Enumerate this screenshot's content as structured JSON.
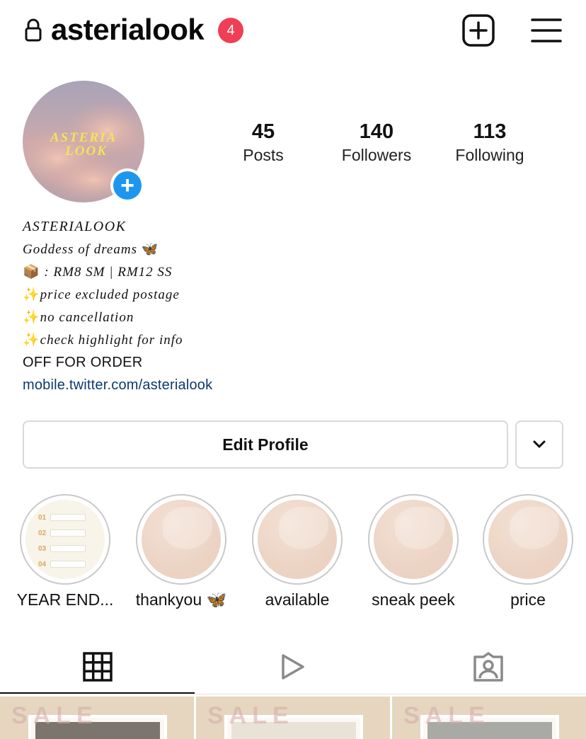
{
  "header": {
    "username": "asterialook",
    "notification_count": "4",
    "icons": [
      "lock-icon",
      "new-post-icon",
      "menu-icon"
    ]
  },
  "profile": {
    "avatar_text": "ASTERIA LOOK",
    "stats": [
      {
        "value": "45",
        "label": "Posts"
      },
      {
        "value": "140",
        "label": "Followers"
      },
      {
        "value": "113",
        "label": "Following"
      }
    ]
  },
  "bio": {
    "name": "ASTERIALOOK",
    "line1_text": "Goddess of dreams",
    "line1_emoji": "🦋",
    "line2_emoji": "📦",
    "line2_text": ": RM8 SM | RM12 SS",
    "line3_emoji": "✨",
    "line3_text": "price excluded postage",
    "line4_emoji": "✨",
    "line4_text": "no cancellation",
    "line5_emoji": "✨",
    "line5_text": "check highlight for info",
    "line6_text": "OFF FOR ORDER",
    "link": "mobile.twitter.com/asterialook"
  },
  "actions": {
    "edit_profile_label": "Edit Profile"
  },
  "highlights": [
    {
      "label": "YEAR END..."
    },
    {
      "label": "thankyou 🦋"
    },
    {
      "label": "available"
    },
    {
      "label": "sneak peek"
    },
    {
      "label": "price"
    }
  ],
  "highlight_doc_numbers": [
    "01",
    "02",
    "03",
    "04"
  ],
  "tabs": [
    {
      "icon": "grid-icon",
      "active": true
    },
    {
      "icon": "reels-icon",
      "active": false
    },
    {
      "icon": "tagged-icon",
      "active": false
    }
  ],
  "posts": [
    {
      "overlay_text": "SALE"
    },
    {
      "overlay_text": "SALE"
    },
    {
      "overlay_text": "SALE"
    }
  ],
  "colors": {
    "notification_badge": "#ef3e56",
    "add_button": "#1d96f0",
    "link": "#0d3a6b"
  }
}
